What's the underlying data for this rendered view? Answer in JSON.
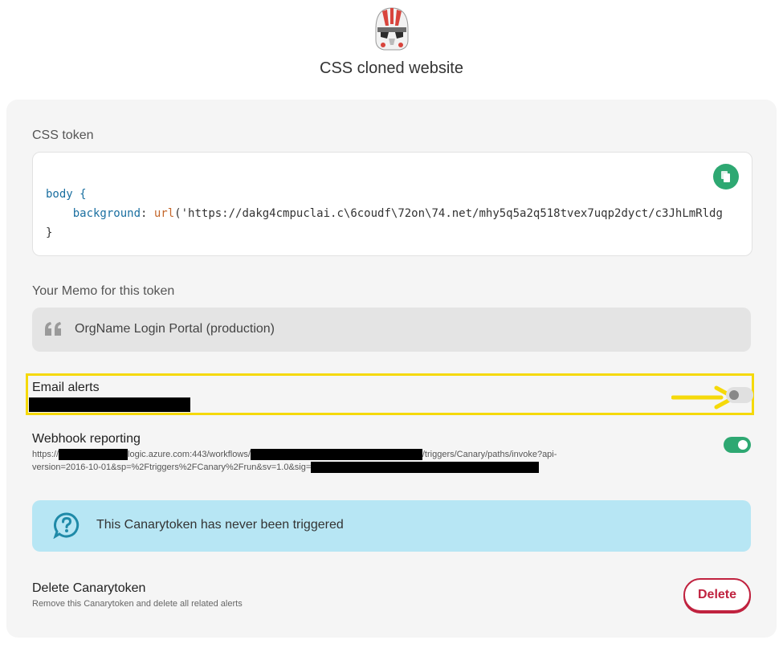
{
  "header": {
    "title": "CSS cloned website",
    "logo_icon": "trooper-helmet-icon"
  },
  "css_token": {
    "label": "CSS token",
    "code_line1": "body {",
    "code_prop": "background",
    "code_fn": "url",
    "code_url": "('https://dakg4cmpuclai.c\\6coudf\\72on\\74.net/mhy5q5a2q518tvex7uqp2dyct/c3JhLmRldg",
    "code_line3": "}",
    "copy_icon": "copy-icon"
  },
  "memo": {
    "label": "Your Memo for this token",
    "value": "OrgName Login Portal (production)",
    "icon": "quote-icon"
  },
  "email_alerts": {
    "title": "Email alerts",
    "enabled": false
  },
  "webhook": {
    "title": "Webhook reporting",
    "enabled": true,
    "url_part1": "https://",
    "url_part2": "logic.azure.com:443/workflows/",
    "url_part3": "/triggers/Canary/paths/invoke?api-",
    "url_part4": "version=2016-10-01&sp=%2Ftriggers%2FCanary%2Frun&sv=1.0&sig="
  },
  "info": {
    "text": "This Canarytoken has never been triggered",
    "icon": "question-chat-icon"
  },
  "delete": {
    "title": "Delete Canarytoken",
    "subtitle": "Remove this Canarytoken and delete all related alerts",
    "button_label": "Delete"
  },
  "colors": {
    "accent_green": "#2ea872",
    "highlight_yellow": "#f5d90a",
    "danger_red": "#c0223f",
    "info_blue": "#b7e6f4"
  }
}
